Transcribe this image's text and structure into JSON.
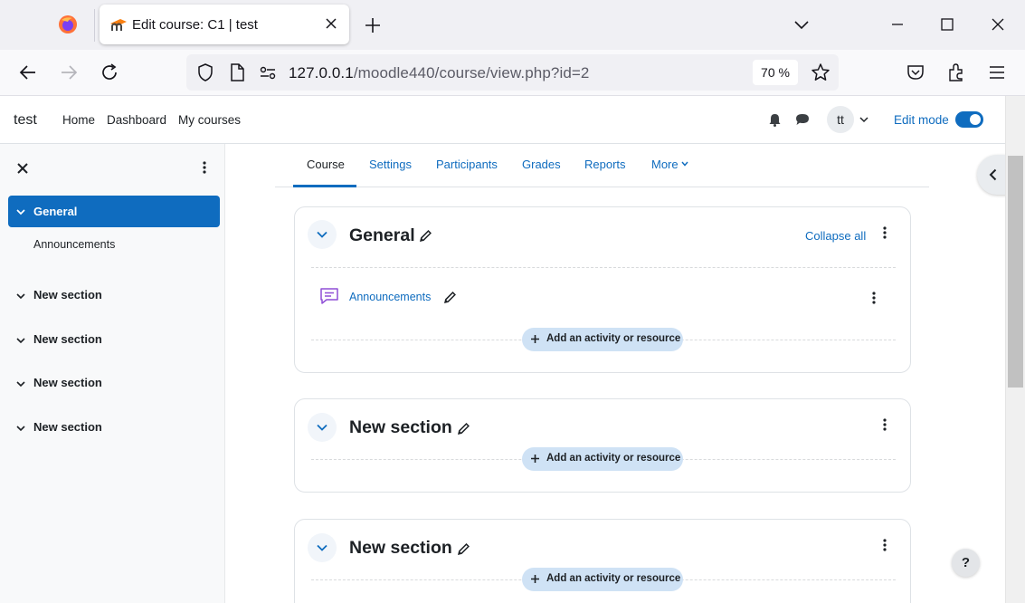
{
  "browser": {
    "tab_title": "Edit course: C1 | test",
    "url_host": "127.0.0.1",
    "url_path": "/moodle440/course/view.php?id=2",
    "zoom": "70 %",
    "icons": [
      "firefox-logo-icon",
      "moodle-favicon-icon",
      "close-icon",
      "plus-icon",
      "chevron-down-icon",
      "minimize-icon",
      "maximize-icon",
      "close-window-icon",
      "back-icon",
      "forward-icon",
      "reload-icon",
      "shield-icon",
      "page-icon",
      "permissions-icon",
      "star-icon",
      "pocket-icon",
      "extensions-icon",
      "menu-icon"
    ]
  },
  "moodle_nav": {
    "site_name": "test",
    "links": [
      "Home",
      "Dashboard",
      "My courses"
    ],
    "avatar_initials": "tt",
    "edit_mode_label": "Edit mode",
    "edit_mode_on": true
  },
  "course_index": {
    "active_section": "General",
    "active_children": [
      "Announcements"
    ],
    "sections": [
      "New section",
      "New section",
      "New section",
      "New section"
    ]
  },
  "secondary_nav": {
    "tabs": [
      "Course",
      "Settings",
      "Participants",
      "Grades",
      "Reports",
      "More"
    ],
    "active": "Course"
  },
  "sections": [
    {
      "title": "General",
      "collapse_all": "Collapse all",
      "activities": [
        {
          "name": "Announcements",
          "type": "forum"
        }
      ],
      "add_label": "Add an activity or resource"
    },
    {
      "title": "New section",
      "add_label": "Add an activity or resource"
    },
    {
      "title": "New section",
      "add_label": "Add an activity or resource"
    }
  ],
  "help_label": "?",
  "colors": {
    "brand": "#0f6cbf",
    "active_bg": "#0f6cbf",
    "add_button_bg": "#cfe2f5"
  }
}
